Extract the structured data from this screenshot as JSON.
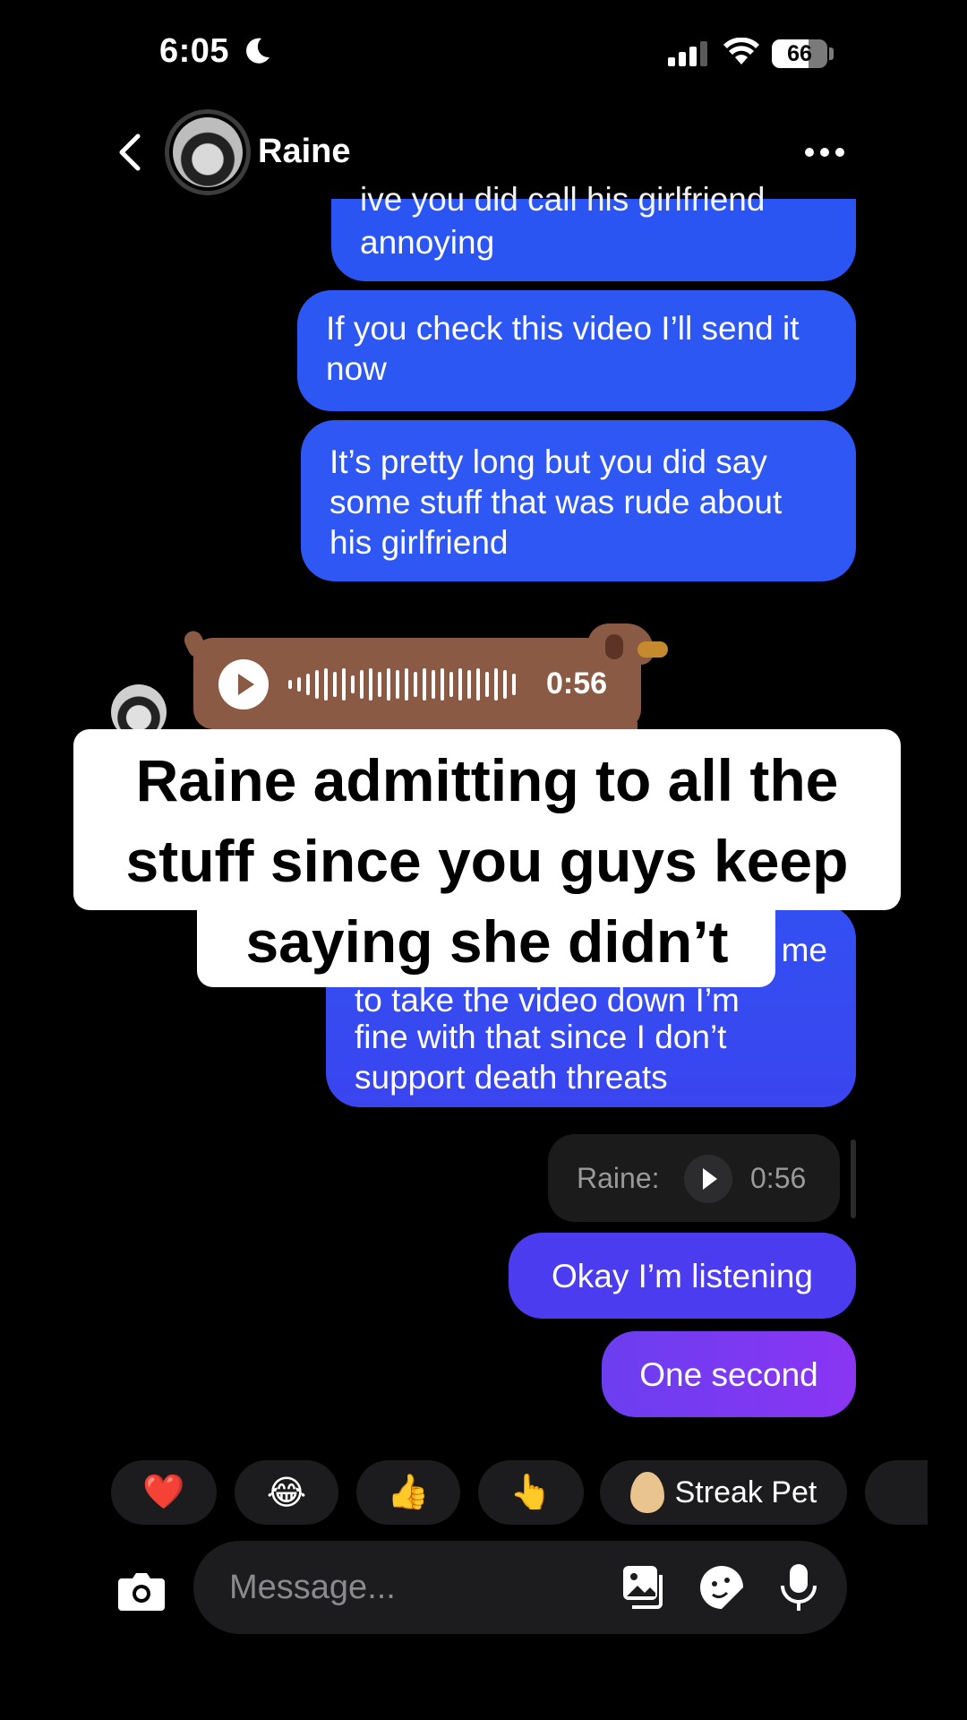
{
  "status_bar": {
    "time": "6:05",
    "battery": "66"
  },
  "header": {
    "contact_name": "Raine"
  },
  "messages": {
    "m1_partial": "ive you did call his girlfriend",
    "m1_line2": "annoying",
    "m2": "If you check this video I’ll send it now",
    "m3": "It’s pretty long but you did say some stuff that was rude about his girlfriend",
    "m4_partial": "me",
    "m4_clipped": "to take the video down I’m",
    "m4_line3": "fine with that since I don’t",
    "m4_line4": "support death threats",
    "m5": "Okay I’m listening",
    "m6": "One second"
  },
  "voice_message": {
    "duration": "0:56"
  },
  "caption": {
    "text": "Raine admitting to all the stuff since you guys keep saying she didn’t"
  },
  "reply_card": {
    "name": "Raine:",
    "duration": "0:56"
  },
  "reactions": [
    {
      "emoji": "❤️"
    },
    {
      "emoji": "😂"
    },
    {
      "emoji": "👍"
    },
    {
      "emoji": "👆"
    },
    {
      "label": "Streak Pet"
    }
  ],
  "composer": {
    "placeholder": "Message..."
  }
}
